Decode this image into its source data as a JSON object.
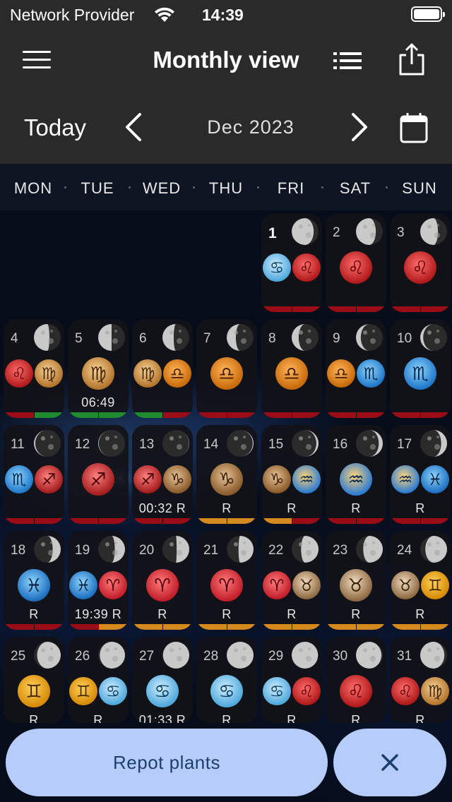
{
  "status_bar": {
    "carrier": "Network Provider",
    "time": "14:39"
  },
  "header": {
    "title": "Monthly view",
    "today_label": "Today",
    "month_label": "Dec 2023"
  },
  "weekdays": [
    "MON",
    "TUE",
    "WED",
    "THU",
    "FRI",
    "SAT",
    "SUN"
  ],
  "colors": {
    "green": "#1e8c2e",
    "red": "#9a0d17",
    "orange": "#d48a1e",
    "button": "#b6cdfb"
  },
  "days": [
    {
      "day": "1",
      "today": true,
      "moon_lit": 0.82,
      "waning": true,
      "signs": [
        "cancer",
        "leo"
      ],
      "note": "",
      "bar_left": "red",
      "bar_right": "red"
    },
    {
      "day": "2",
      "moon_lit": 0.74,
      "waning": true,
      "signs": [
        "leo"
      ],
      "note": "",
      "bar_left": "red",
      "bar_right": "red"
    },
    {
      "day": "3",
      "moon_lit": 0.66,
      "waning": true,
      "signs": [
        "leo"
      ],
      "note": "",
      "bar_left": "red",
      "bar_right": "red"
    },
    {
      "day": "4",
      "moon_lit": 0.58,
      "waning": true,
      "signs": [
        "leo",
        "virgo"
      ],
      "note": "",
      "bar_left": "red",
      "bar_right": "green"
    },
    {
      "day": "5",
      "moon_lit": 0.5,
      "waning": true,
      "signs": [
        "virgo"
      ],
      "note": "06:49",
      "bar_left": "green",
      "bar_right": "green"
    },
    {
      "day": "6",
      "moon_lit": 0.42,
      "waning": true,
      "signs": [
        "virgo",
        "libra"
      ],
      "note": "",
      "bar_left": "green",
      "bar_right": "red"
    },
    {
      "day": "7",
      "moon_lit": 0.34,
      "waning": true,
      "signs": [
        "libra"
      ],
      "note": "",
      "bar_left": "red",
      "bar_right": "red"
    },
    {
      "day": "8",
      "moon_lit": 0.26,
      "waning": true,
      "signs": [
        "libra"
      ],
      "note": "",
      "bar_left": "red",
      "bar_right": "red"
    },
    {
      "day": "9",
      "moon_lit": 0.18,
      "waning": true,
      "signs": [
        "libra",
        "scorpio"
      ],
      "note": "",
      "bar_left": "red",
      "bar_right": "red"
    },
    {
      "day": "10",
      "moon_lit": 0.11,
      "waning": true,
      "signs": [
        "scorpio"
      ],
      "note": "",
      "bar_left": "red",
      "bar_right": "red"
    },
    {
      "day": "11",
      "moon_lit": 0.05,
      "waning": true,
      "signs": [
        "scorpio",
        "sagittarius"
      ],
      "note": "",
      "bar_left": "red",
      "bar_right": "red"
    },
    {
      "day": "12",
      "moon_lit": 0.02,
      "waning": true,
      "signs": [
        "sagittarius"
      ],
      "note": "",
      "bar_left": "red",
      "bar_right": "red"
    },
    {
      "day": "13",
      "moon_lit": 0.01,
      "waning": false,
      "signs": [
        "sagittarius",
        "capricorn"
      ],
      "note": "00:32 R",
      "bar_left": "red",
      "bar_right": "red"
    },
    {
      "day": "14",
      "moon_lit": 0.03,
      "waning": false,
      "signs": [
        "capricorn"
      ],
      "note": "R",
      "bar_left": "orange",
      "bar_right": "orange"
    },
    {
      "day": "15",
      "moon_lit": 0.08,
      "waning": false,
      "signs": [
        "capricorn",
        "aquarius"
      ],
      "note": "R",
      "bar_left": "orange",
      "bar_right": "red"
    },
    {
      "day": "16",
      "moon_lit": 0.15,
      "waning": false,
      "signs": [
        "aquarius"
      ],
      "note": "R",
      "bar_left": "red",
      "bar_right": "red"
    },
    {
      "day": "17",
      "moon_lit": 0.22,
      "waning": false,
      "signs": [
        "aquarius",
        "pisces"
      ],
      "note": "R",
      "bar_left": "red",
      "bar_right": "red"
    },
    {
      "day": "18",
      "moon_lit": 0.3,
      "waning": false,
      "signs": [
        "pisces"
      ],
      "note": "R",
      "bar_left": "red",
      "bar_right": "red"
    },
    {
      "day": "19",
      "moon_lit": 0.38,
      "waning": false,
      "signs": [
        "pisces",
        "aries"
      ],
      "note": "19:39 R",
      "bar_left": "red",
      "bar_right": "orange"
    },
    {
      "day": "20",
      "moon_lit": 0.47,
      "waning": false,
      "signs": [
        "aries"
      ],
      "note": "R",
      "bar_left": "orange",
      "bar_right": "orange"
    },
    {
      "day": "21",
      "moon_lit": 0.56,
      "waning": false,
      "signs": [
        "aries"
      ],
      "note": "R",
      "bar_left": "orange",
      "bar_right": "orange"
    },
    {
      "day": "22",
      "moon_lit": 0.65,
      "waning": false,
      "signs": [
        "aries",
        "taurus"
      ],
      "note": "R",
      "bar_left": "orange",
      "bar_right": "orange"
    },
    {
      "day": "23",
      "moon_lit": 0.73,
      "waning": false,
      "signs": [
        "taurus"
      ],
      "note": "R",
      "bar_left": "orange",
      "bar_right": "orange"
    },
    {
      "day": "24",
      "moon_lit": 0.81,
      "waning": false,
      "signs": [
        "taurus",
        "gemini"
      ],
      "note": "R",
      "bar_left": "orange",
      "bar_right": "orange"
    },
    {
      "day": "25",
      "moon_lit": 0.88,
      "waning": false,
      "signs": [
        "gemini"
      ],
      "note": "R",
      "bar_left": "",
      "bar_right": ""
    },
    {
      "day": "26",
      "moon_lit": 0.94,
      "waning": false,
      "signs": [
        "gemini",
        "cancer"
      ],
      "note": "R",
      "bar_left": "",
      "bar_right": ""
    },
    {
      "day": "27",
      "moon_lit": 0.98,
      "waning": false,
      "signs": [
        "cancer"
      ],
      "note": "01:33 R",
      "bar_left": "",
      "bar_right": ""
    },
    {
      "day": "28",
      "moon_lit": 1.0,
      "waning": true,
      "signs": [
        "cancer"
      ],
      "note": "R",
      "bar_left": "",
      "bar_right": ""
    },
    {
      "day": "29",
      "moon_lit": 0.98,
      "waning": true,
      "signs": [
        "cancer",
        "leo"
      ],
      "note": "R",
      "bar_left": "",
      "bar_right": ""
    },
    {
      "day": "30",
      "moon_lit": 0.95,
      "waning": true,
      "signs": [
        "leo"
      ],
      "note": "R",
      "bar_left": "",
      "bar_right": ""
    },
    {
      "day": "31",
      "moon_lit": 0.9,
      "waning": true,
      "signs": [
        "leo",
        "virgo"
      ],
      "note": "R",
      "bar_left": "",
      "bar_right": ""
    }
  ],
  "sign_glyphs": {
    "cancer": "♋",
    "leo": "♌",
    "virgo": "♍",
    "libra": "♎",
    "scorpio": "♏",
    "sagittarius": "♐",
    "capricorn": "♑",
    "aquarius": "♒",
    "pisces": "♓",
    "aries": "♈",
    "taurus": "♉",
    "gemini": "♊"
  },
  "footer": {
    "action_label": "Repot plants"
  }
}
